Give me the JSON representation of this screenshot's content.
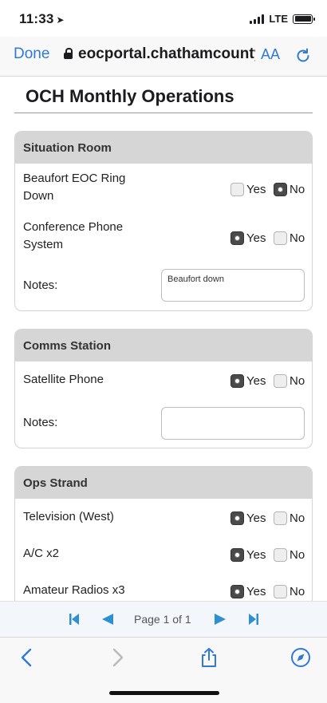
{
  "status": {
    "time": "11:33",
    "network": "LTE"
  },
  "nav": {
    "done_label": "Done",
    "url": "eocportal.chathamcounty",
    "text_size_label": "AA"
  },
  "page": {
    "title": "OCH Monthly Operations"
  },
  "sections": [
    {
      "title": "Situation Room",
      "items": [
        {
          "label": "Beaufort EOC Ring Down",
          "yes_label": "Yes",
          "no_label": "No",
          "selected": "No"
        },
        {
          "label": "Conference Phone System",
          "yes_label": "Yes",
          "no_label": "No",
          "selected": "Yes"
        }
      ],
      "notes_label": "Notes:",
      "notes_value": "Beaufort down"
    },
    {
      "title": "Comms Station",
      "items": [
        {
          "label": "Satellite Phone",
          "yes_label": "Yes",
          "no_label": "No",
          "selected": "Yes"
        }
      ],
      "notes_label": "Notes:",
      "notes_value": ""
    },
    {
      "title": "Ops Strand",
      "items": [
        {
          "label": "Television (West)",
          "yes_label": "Yes",
          "no_label": "No",
          "selected": "Yes"
        },
        {
          "label": "A/C x2",
          "yes_label": "Yes",
          "no_label": "No",
          "selected": "Yes"
        },
        {
          "label": "Amateur Radios x3",
          "yes_label": "Yes",
          "no_label": "No",
          "selected": "Yes"
        }
      ]
    }
  ],
  "pager": {
    "text": "Page 1 of 1"
  },
  "colors": {
    "accent": "#2f7ad6",
    "pager_icon": "#2e8fd1",
    "section_header": "#d6d6d6"
  },
  "icons": [
    "location-arrow-icon",
    "signal-icon",
    "battery-icon",
    "lock-icon",
    "reload-icon",
    "first-page-icon",
    "prev-page-icon",
    "next-page-icon",
    "last-page-icon",
    "back-icon",
    "forward-icon",
    "share-icon",
    "compass-icon"
  ]
}
